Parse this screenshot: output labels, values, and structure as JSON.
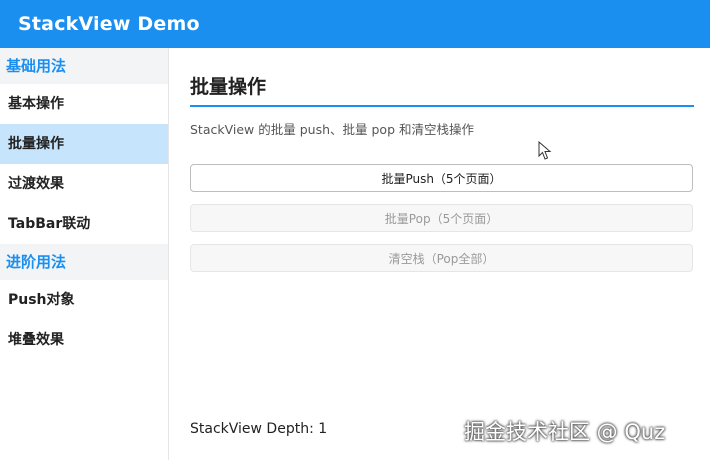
{
  "header": {
    "title": "StackView Demo"
  },
  "sidebar": {
    "groups": [
      {
        "label": "基础用法",
        "items": [
          {
            "label": "基本操作"
          },
          {
            "label": "批量操作",
            "active": true
          },
          {
            "label": "过渡效果"
          },
          {
            "label": "TabBar联动"
          }
        ]
      },
      {
        "label": "进阶用法",
        "items": [
          {
            "label": "Push对象"
          },
          {
            "label": "堆叠效果"
          }
        ]
      }
    ]
  },
  "main": {
    "title": "批量操作",
    "description": "StackView 的批量 push、批量 pop 和清空栈操作",
    "buttons": {
      "push": "批量Push（5个页面）",
      "pop": "批量Pop（5个页面）",
      "clear": "清空栈（Pop全部）"
    },
    "depth_text": "StackView Depth: 1"
  },
  "watermark": "掘金技术社区 @ Quz",
  "colors": {
    "accent": "#1b8ff0",
    "active_item_bg": "#c6e4fb",
    "group_bg": "#f2f4f6"
  }
}
